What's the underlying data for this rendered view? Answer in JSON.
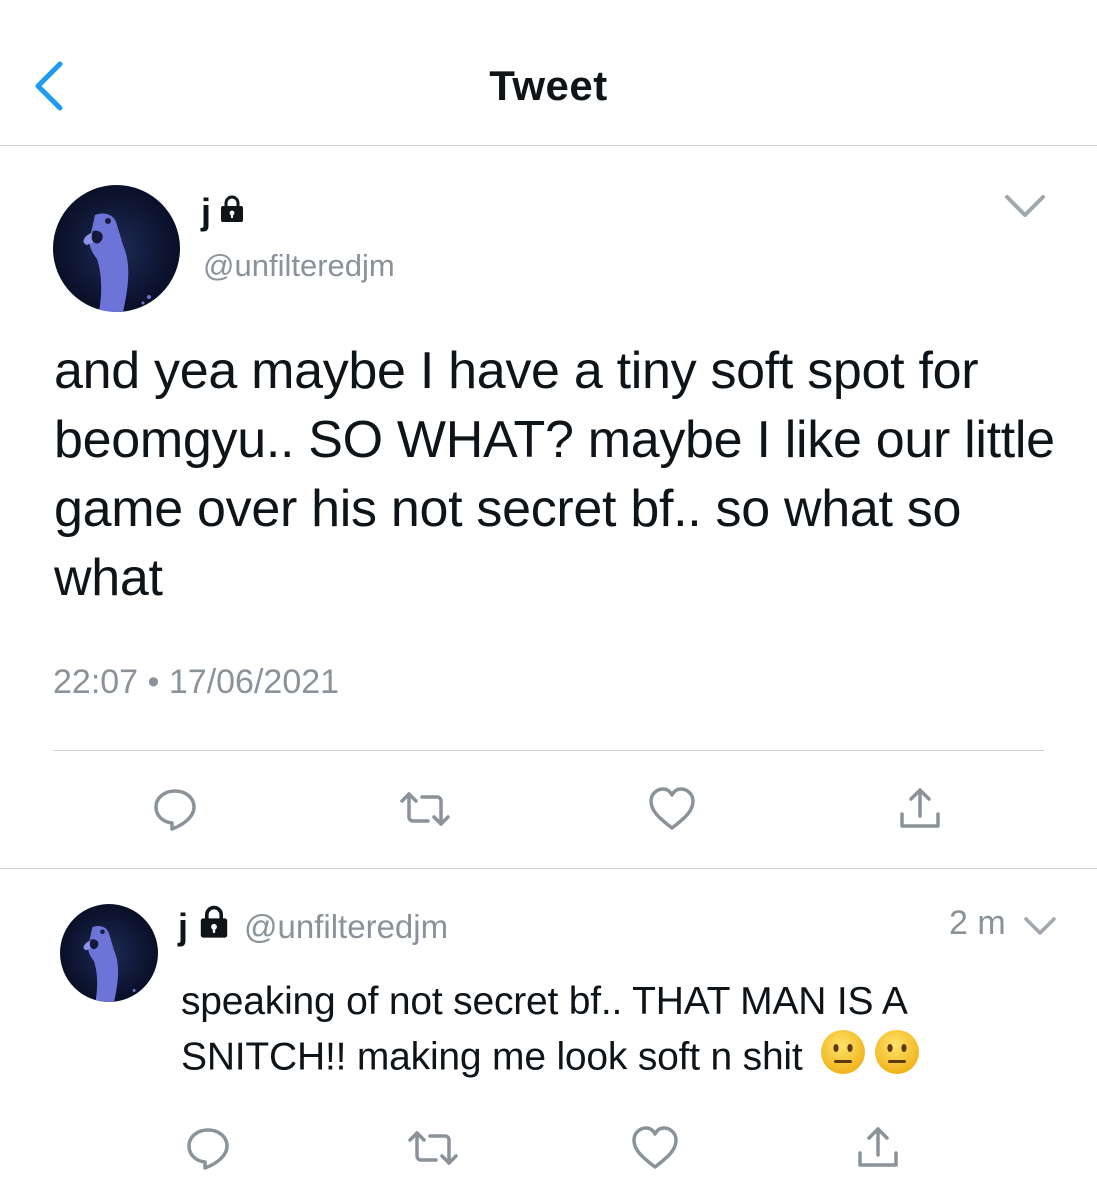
{
  "navbar": {
    "title": "Tweet"
  },
  "main_tweet": {
    "name": "j",
    "handle": "@unfilteredjm",
    "text": "and yea maybe I have a tiny soft spot for beomgyu.. SO WHAT? maybe I like our little game over his not secret bf.. so what so what",
    "timestamp": "22:07 • 17/06/2021",
    "icons": [
      "chevron-left-icon",
      "lock-icon",
      "chevron-down-icon",
      "reply-icon",
      "retweet-icon",
      "like-icon",
      "share-icon"
    ]
  },
  "reply_tweet": {
    "name": "j",
    "handle": "@unfilteredjm",
    "age": "2 m",
    "text": "speaking of not secret bf.. THAT MAN IS A SNITCH!! making me look soft n shit",
    "emojis": [
      "neutral-face",
      "neutral-face"
    ]
  },
  "colors": {
    "accent": "#1d9bf0",
    "muted": "#8b9299",
    "divider": "#cfd3d6",
    "text": "#0f1419"
  }
}
